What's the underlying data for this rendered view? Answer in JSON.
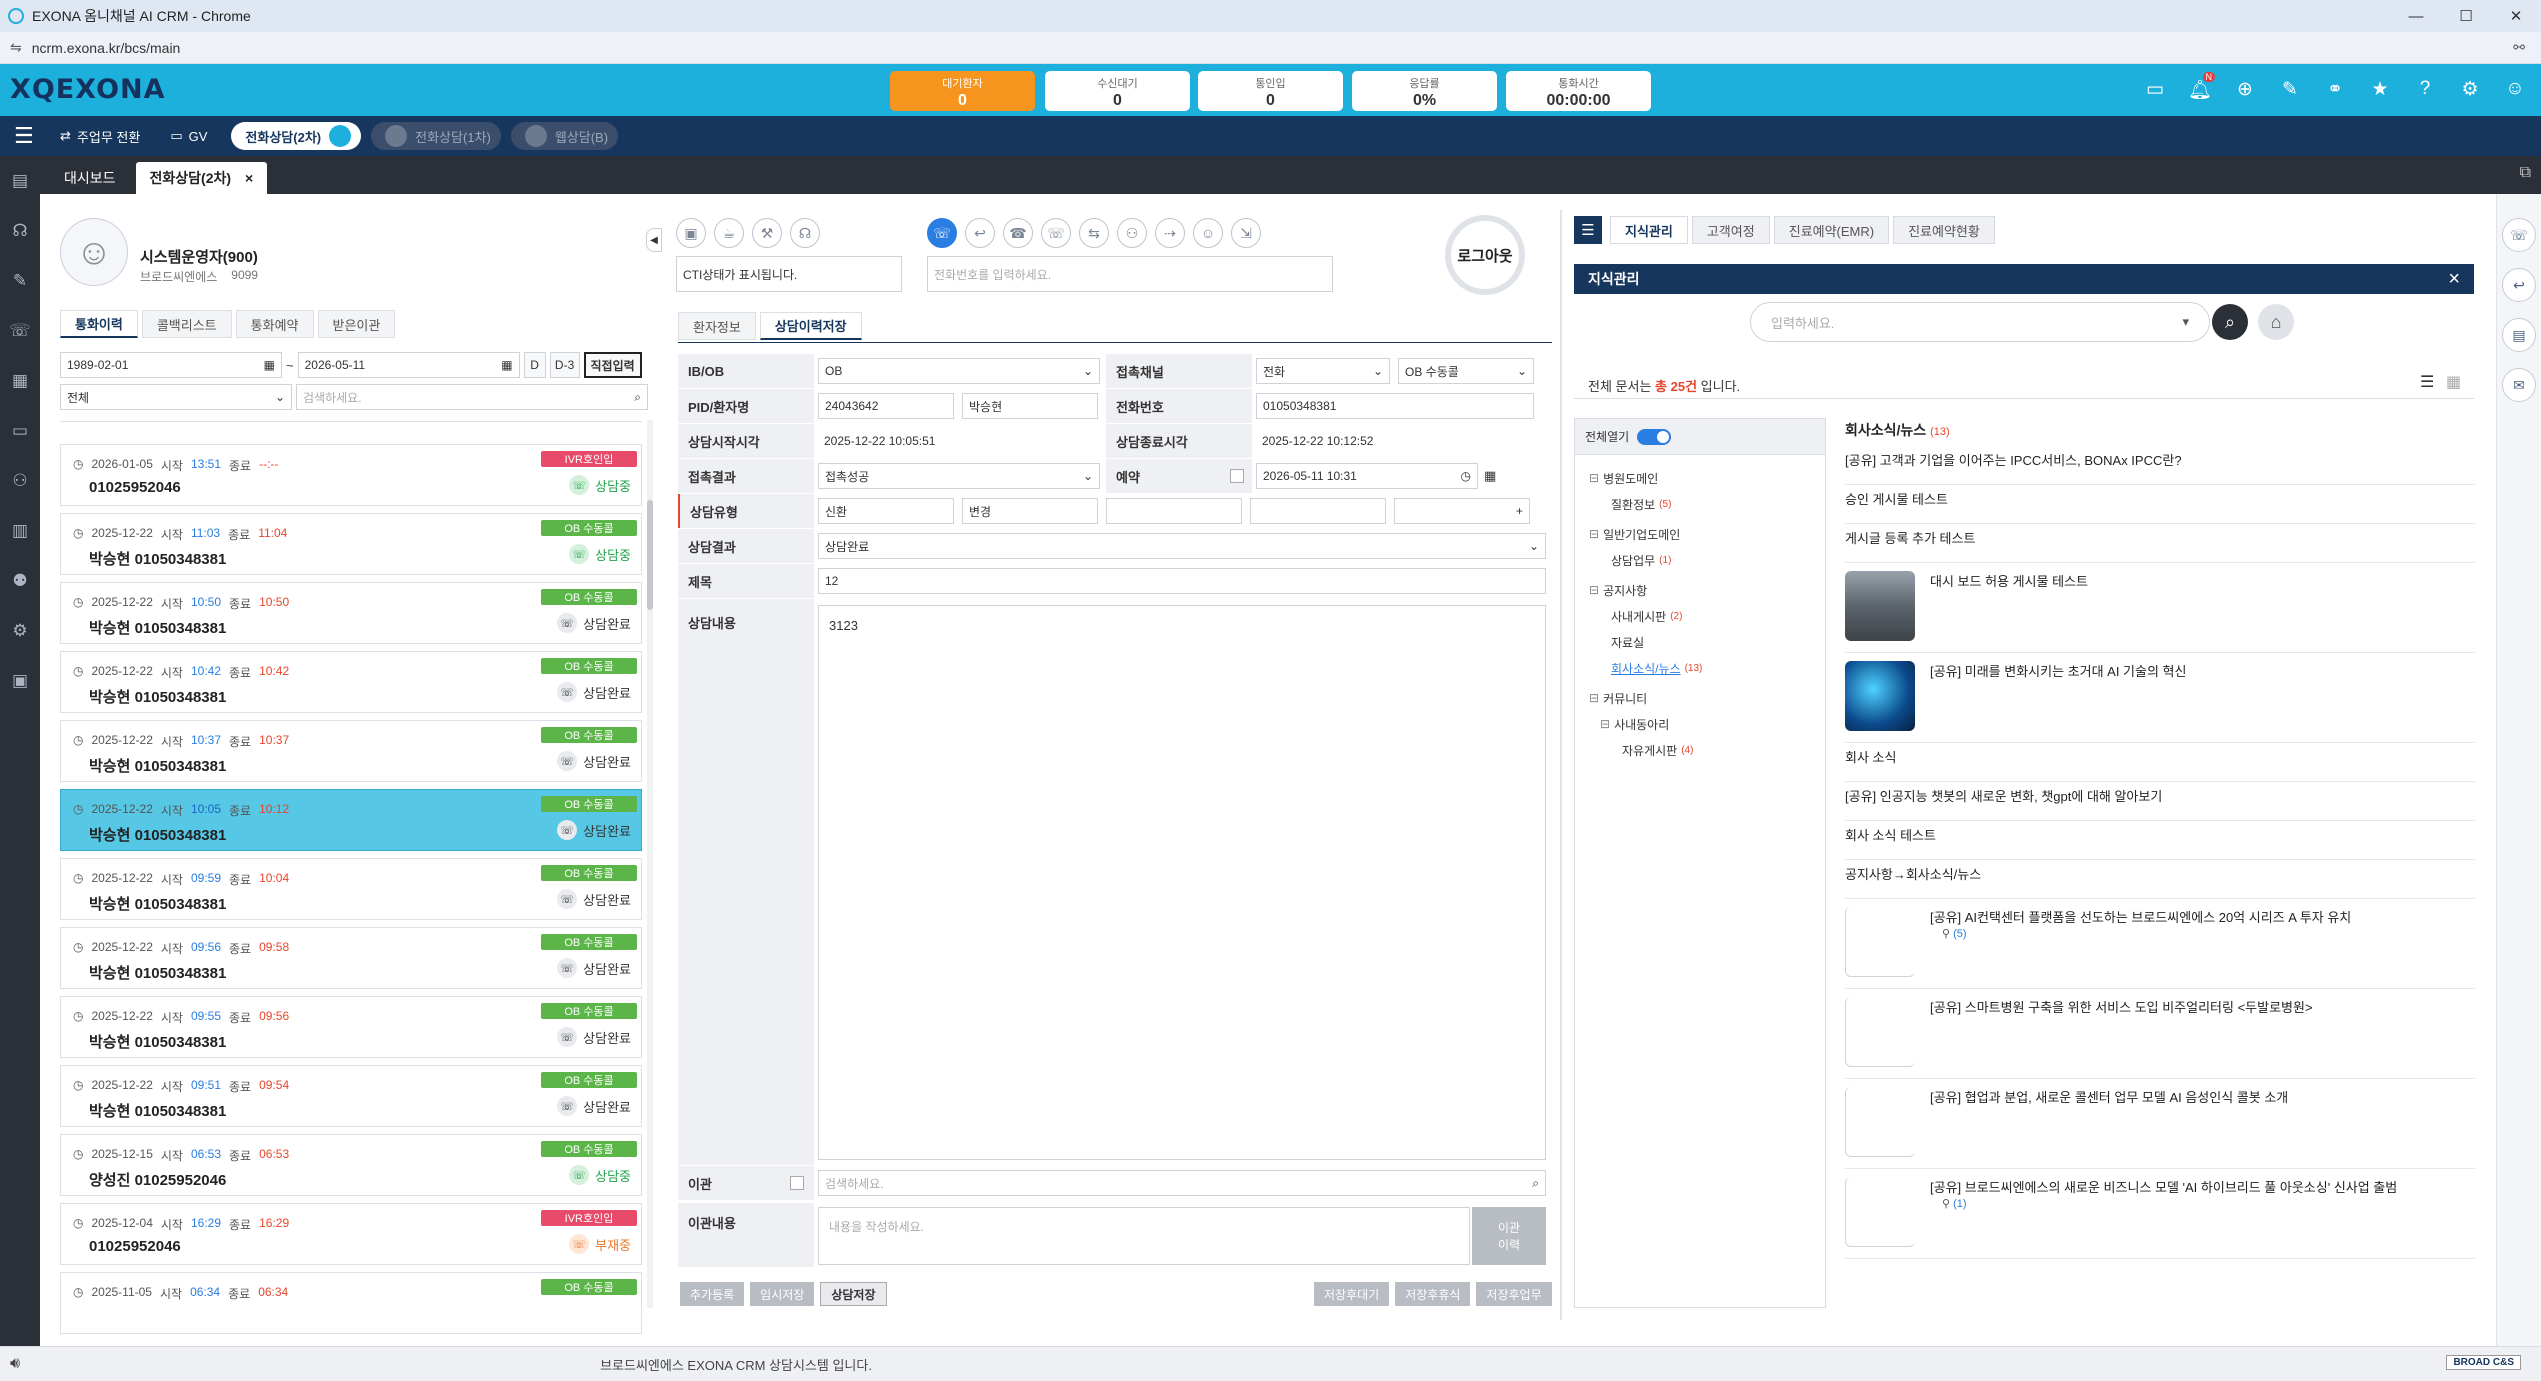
{
  "window": {
    "title": "EXONA 옴니채널 AI CRM - Chrome",
    "url": "ncrm.exona.kr/bcs/main"
  },
  "header": {
    "logo": "XQEXONA",
    "stats": [
      {
        "label": "대기환자",
        "value": "0",
        "active": true
      },
      {
        "label": "수신대기",
        "value": "0"
      },
      {
        "label": "통인입",
        "value": "0"
      },
      {
        "label": "응답률",
        "value": "0%"
      },
      {
        "label": "통화시간",
        "value": "00:00:00"
      }
    ],
    "badge": "N"
  },
  "nav": {
    "work_switch": "주업무 전환",
    "gv": "GV",
    "pills": [
      {
        "label": "전화상담(2차)",
        "on": true
      },
      {
        "label": "전화상담(1차)",
        "on": false
      },
      {
        "label": "웹상담(B)",
        "on": false
      }
    ]
  },
  "tabs": [
    {
      "label": "대시보드"
    },
    {
      "label": "전화상담(2차)",
      "close": "×"
    }
  ],
  "agent": {
    "name": "시스템운영자(900)",
    "company": "브로드씨엔에스",
    "ext": "9099"
  },
  "left_tabs": [
    "통화이력",
    "콜백리스트",
    "통화예약",
    "받은이관"
  ],
  "filter": {
    "start": "1989-02-01",
    "tilde": "~",
    "end": "2026-05-11",
    "btn_d": "D",
    "btn_d3": "D-3",
    "btn_input": "직접입력",
    "select": "전체",
    "search_placeholder": "검색하세요."
  },
  "calls": [
    {
      "date": "2026-01-05",
      "start_label": "시작",
      "start": "13:51",
      "end_label": "종료",
      "end": "--:--",
      "phone": "01025952046",
      "tag": "IVR호인입",
      "tagcolor": "#e84b6a",
      "result": "상담중",
      "state": "green"
    },
    {
      "date": "2025-12-22",
      "start_label": "시작",
      "start": "11:03",
      "end_label": "종료",
      "end": "11:04",
      "phone": "박승현 01050348381",
      "tag": "OB 수동콜",
      "tagcolor": "#5bb548",
      "result": "상담중",
      "state": "green"
    },
    {
      "date": "2025-12-22",
      "start_label": "시작",
      "start": "10:50",
      "end_label": "종료",
      "end": "10:50",
      "phone": "박승현 01050348381",
      "tag": "OB 수동콜",
      "tagcolor": "#5bb548",
      "result": "상담완료",
      "state": "gray"
    },
    {
      "date": "2025-12-22",
      "start_label": "시작",
      "start": "10:42",
      "end_label": "종료",
      "end": "10:42",
      "phone": "박승현 01050348381",
      "tag": "OB 수동콜",
      "tagcolor": "#5bb548",
      "result": "상담완료",
      "state": "gray"
    },
    {
      "date": "2025-12-22",
      "start_label": "시작",
      "start": "10:37",
      "end_label": "종료",
      "end": "10:37",
      "phone": "박승현 01050348381",
      "tag": "OB 수동콜",
      "tagcolor": "#5bb548",
      "result": "상담완료",
      "state": "gray"
    },
    {
      "date": "2025-12-22",
      "start_label": "시작",
      "start": "10:05",
      "end_label": "종료",
      "end": "10:12",
      "phone": "박승현 01050348381",
      "tag": "OB 수동콜",
      "tagcolor": "#5bb548",
      "result": "상담완료",
      "state": "gray",
      "selected": true
    },
    {
      "date": "2025-12-22",
      "start_label": "시작",
      "start": "09:59",
      "end_label": "종료",
      "end": "10:04",
      "phone": "박승현 01050348381",
      "tag": "OB 수동콜",
      "tagcolor": "#5bb548",
      "result": "상담완료",
      "state": "gray"
    },
    {
      "date": "2025-12-22",
      "start_label": "시작",
      "start": "09:56",
      "end_label": "종료",
      "end": "09:58",
      "phone": "박승현 01050348381",
      "tag": "OB 수동콜",
      "tagcolor": "#5bb548",
      "result": "상담완료",
      "state": "gray"
    },
    {
      "date": "2025-12-22",
      "start_label": "시작",
      "start": "09:55",
      "end_label": "종료",
      "end": "09:56",
      "phone": "박승현 01050348381",
      "tag": "OB 수동콜",
      "tagcolor": "#5bb548",
      "result": "상담완료",
      "state": "gray"
    },
    {
      "date": "2025-12-22",
      "start_label": "시작",
      "start": "09:51",
      "end_label": "종료",
      "end": "09:54",
      "phone": "박승현 01050348381",
      "tag": "OB 수동콜",
      "tagcolor": "#5bb548",
      "result": "상담완료",
      "state": "gray"
    },
    {
      "date": "2025-12-15",
      "start_label": "시작",
      "start": "06:53",
      "end_label": "종료",
      "end": "06:53",
      "phone": "양성진 01025952046",
      "tag": "OB 수동콜",
      "tagcolor": "#5bb548",
      "result": "상담중",
      "state": "green"
    },
    {
      "date": "2025-12-04",
      "start_label": "시작",
      "start": "16:29",
      "end_label": "종료",
      "end": "16:29",
      "phone": "01025952046",
      "tag": "IVR호인입",
      "tagcolor": "#e84b6a",
      "result": "부재중",
      "state": "orange"
    },
    {
      "date": "2025-11-05",
      "start_label": "시작",
      "start": "06:34",
      "end_label": "종료",
      "end": "06:34",
      "phone": "",
      "tag": "OB 수동콜",
      "tagcolor": "#5bb548",
      "result": "",
      "state": "gray"
    }
  ],
  "cti": {
    "status": "CTI상태가 표시됩니다.",
    "phone_placeholder": "전화번호를 입력하세요.",
    "logout": "로그아웃"
  },
  "form_tabs": [
    "환자정보",
    "상담이력저장"
  ],
  "form": {
    "ibob_label": "IB/OB",
    "ibob": "OB",
    "channel_label": "접촉채널",
    "channel": "전화",
    "channel_sub": "OB 수동콜",
    "pid_label": "PID/환자명",
    "pid": "24043642",
    "patient": "박승현",
    "phone_label": "전화번호",
    "phone": "01050348381",
    "start_label": "상담시작시각",
    "start": "2025-12-22 10:05:51",
    "end_label": "상담종료시각",
    "end": "2025-12-22 10:12:52",
    "contact_result_label": "접촉결과",
    "contact_result": "접촉성공",
    "reserve_label": "예약",
    "reserve_dt": "2026-05-11 10:31",
    "type_label": "상담유형",
    "type1": "신환",
    "type2": "변경",
    "result_label": "상담결과",
    "result": "상담완료",
    "title_label": "제목",
    "title": "12",
    "content_label": "상담내용",
    "content": "3123",
    "transfer_label": "이관",
    "transfer_placeholder": "검색하세요.",
    "transfer_content_label": "이관내용",
    "transfer_content_placeholder": "내용을 작성하세요.",
    "transfer_btn": "이관\n이력"
  },
  "form_buttons": {
    "add": "추가등록",
    "temp": "임시저장",
    "save": "상담저장",
    "save_wait": "저장후대기",
    "save_rest": "저장후휴식",
    "save_work": "저장후업무"
  },
  "knowledge": {
    "tabs": [
      "지식관리",
      "고객여정",
      "진료예약(EMR)",
      "진료예약현황"
    ],
    "panel_title": "지식관리",
    "close": "×",
    "search_placeholder": "입력하세요.",
    "total_prefix": "전체 문서는",
    "total_count": "총 25건",
    "total_suffix": "입니다.",
    "expand_all": "전체열기",
    "tree": [
      {
        "label": "병원도메인",
        "lvl": 0,
        "box": "⊟"
      },
      {
        "label": "질환정보",
        "lvl": 2,
        "count": "(5)"
      },
      {
        "label": "일반기업도메인",
        "lvl": 0,
        "box": "⊟"
      },
      {
        "label": "상담업무",
        "lvl": 2,
        "count": "(1)"
      },
      {
        "label": "공지사항",
        "lvl": 0,
        "box": "⊟"
      },
      {
        "label": "사내게시판",
        "lvl": 2,
        "count": "(2)"
      },
      {
        "label": "자료실",
        "lvl": 2
      },
      {
        "label": "회사소식/뉴스",
        "lvl": 2,
        "count": "(13)",
        "link": true
      },
      {
        "label": "커뮤니티",
        "lvl": 0,
        "box": "⊟"
      },
      {
        "label": "사내동아리",
        "lvl": 1,
        "box": "⊟"
      },
      {
        "label": "자유게시판",
        "lvl": 3,
        "count": "(4)"
      }
    ],
    "section_title": "회사소식/뉴스",
    "section_count": "(13)",
    "items": [
      {
        "title": "[공유] 고객과 기업을 이어주는 IPCC서비스, BONAx IPCC란?"
      },
      {
        "title": "승인 게시물 테스트"
      },
      {
        "title": "게시글 등록 추가 테스트"
      },
      {
        "title": "대시 보드 허용 게시물 테스트",
        "thumb": "road"
      },
      {
        "title": "[공유] 미래를 변화시키는 초거대 AI 기술의 혁신",
        "thumb": "ai"
      },
      {
        "title": "회사 소식"
      },
      {
        "title": "[공유] 인공지능 챗봇의 새로운 변화, 챗gpt에 대해 알아보기"
      },
      {
        "title": "회사 소식 테스트"
      },
      {
        "title": "공지사항→회사소식/뉴스"
      },
      {
        "title": "[공유] AI컨택센터 플랫폼을 선도하는 브로드씨엔에스 20억 시리즈 A 투자 유치",
        "attach": "(5)",
        "thumb": "blank"
      },
      {
        "title": "[공유] 스마트병원 구축을 위한 서비스 도입 비주얼리터링 <두발로병원>",
        "thumb": "blank"
      },
      {
        "title": "[공유] 협업과 분업, 새로운 콜센터 업무 모델 AI 음성인식 콜봇 소개",
        "thumb": "blank"
      },
      {
        "title": "[공유] 브로드씨엔에스의 새로운 비즈니스 모델 'AI 하이브리드 풀 아웃소싱' 신사업 출범",
        "attach": "(1)",
        "thumb": "blank"
      }
    ]
  },
  "status": {
    "text": "브로드씨엔에스 EXONA CRM 상담시스템 입니다.",
    "brand": "BROAD C&S"
  },
  "colors": {
    "header": "#1eb0dd",
    "nav": "#16365e",
    "accent": "#f7941d",
    "selected_row": "#56c7e4",
    "link": "#2a7de1"
  }
}
